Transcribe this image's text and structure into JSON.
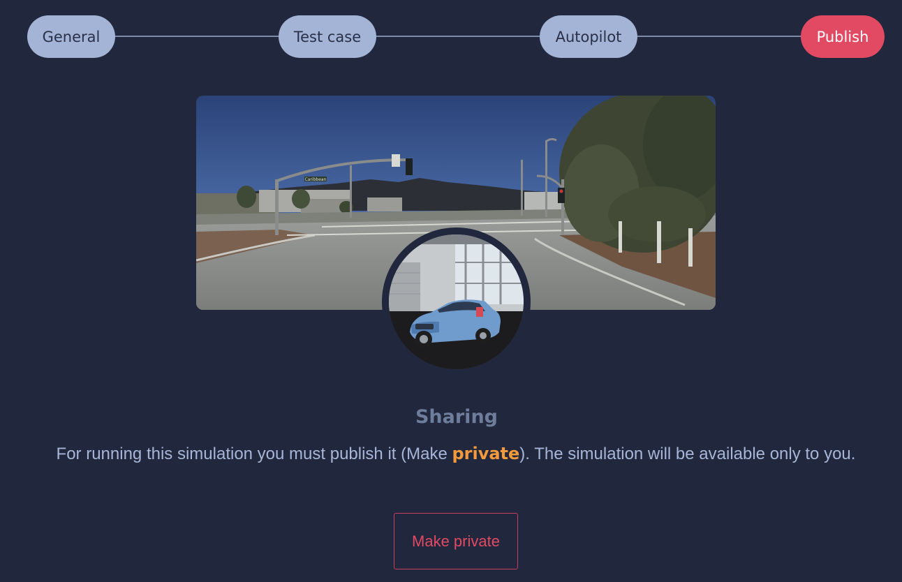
{
  "stepper": {
    "steps": [
      {
        "label": "General",
        "active": false
      },
      {
        "label": "Test case",
        "active": false
      },
      {
        "label": "Autopilot",
        "active": false
      },
      {
        "label": "Publish",
        "active": true
      }
    ]
  },
  "colors": {
    "background": "#21273c",
    "step_inactive": "#a3b4d6",
    "step_active": "#e24a64",
    "heading": "#6f7d9c",
    "description": "#a7b6d7",
    "accent": "#f29a3c"
  },
  "scene": {
    "street_sign": "Caribbean"
  },
  "sharing": {
    "title": "Sharing",
    "description_before": "For running this simulation you must publish it (Make ",
    "description_accent": "private",
    "description_after": "). The simulation will be available only to you."
  },
  "actions": {
    "make_private_label": "Make private"
  }
}
